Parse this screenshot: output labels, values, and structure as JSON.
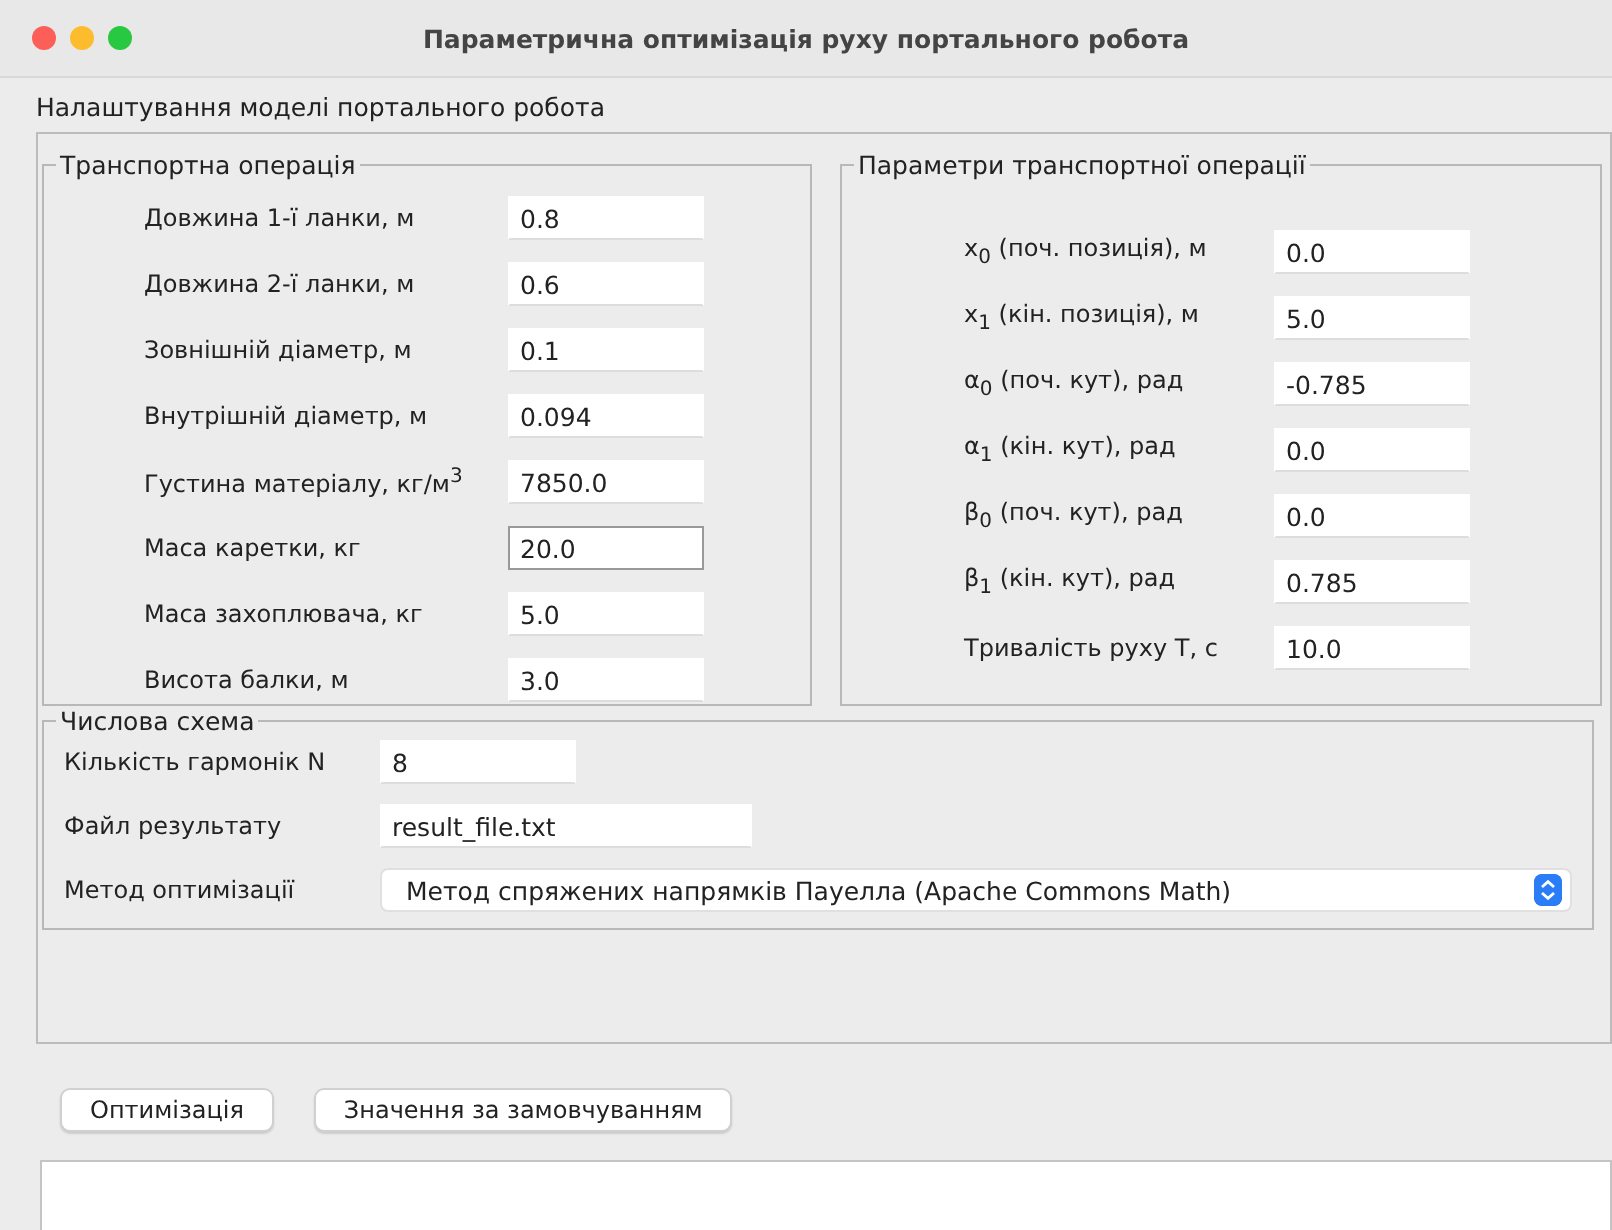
{
  "window": {
    "title": "Параметрична оптимізація руху портального робота"
  },
  "section_title": "Налаштування моделі портального робота",
  "transport_operation": {
    "title": "Транспортна операція",
    "fields": [
      {
        "label": "Довжина 1-ї ланки, м",
        "value": "0.8",
        "focused": false
      },
      {
        "label": "Довжина 2-ї ланки, м",
        "value": "0.6",
        "focused": false
      },
      {
        "label": "Зовнішній діаметр, м",
        "value": "0.1",
        "focused": false
      },
      {
        "label": "Внутрішній діаметр, м",
        "value": "0.094",
        "focused": false
      },
      {
        "label": "Густина матеріалу, кг/м$^{3}$",
        "value": "7850.0",
        "focused": false
      },
      {
        "label": "Маса каретки, кг",
        "value": "20.0",
        "focused": true
      },
      {
        "label": "Маса захоплювача, кг",
        "value": "5.0",
        "focused": false
      },
      {
        "label": "Висота балки, м",
        "value": "3.0",
        "focused": false
      }
    ]
  },
  "operation_parameters": {
    "title": "Параметри транспортної операції",
    "fields": [
      {
        "label": "x$_{0}$ (поч. позиція), м",
        "value": "0.0",
        "focused": false
      },
      {
        "label": "x$_{1}$ (кін. позиція), м",
        "value": "5.0",
        "focused": false
      },
      {
        "label": "α$_{0}$ (поч. кут), рад",
        "value": "-0.785",
        "focused": false
      },
      {
        "label": "α$_{1}$ (кін. кут), рад",
        "value": "0.0",
        "focused": false
      },
      {
        "label": "β$_{0}$ (поч. кут), рад",
        "value": "0.0",
        "focused": false
      },
      {
        "label": "β$_{1}$ (кін. кут), рад",
        "value": "0.785",
        "focused": false
      },
      {
        "label": "Тривалість руху T, с",
        "value": "10.0",
        "focused": false
      }
    ]
  },
  "numerical_scheme": {
    "title": "Числова схема",
    "rows": [
      {
        "kind": "field",
        "label": "Кількість гармонік N",
        "value": "8"
      },
      {
        "kind": "field",
        "label": "Файл результату",
        "value": "result_file.txt"
      },
      {
        "kind": "select",
        "label": "Метод оптимізації",
        "value": "Метод спряжених напрямків Пауелла (Apache Commons Math)"
      }
    ]
  },
  "buttons": [
    "Оптимізація",
    "Значення за замовчуванням"
  ]
}
